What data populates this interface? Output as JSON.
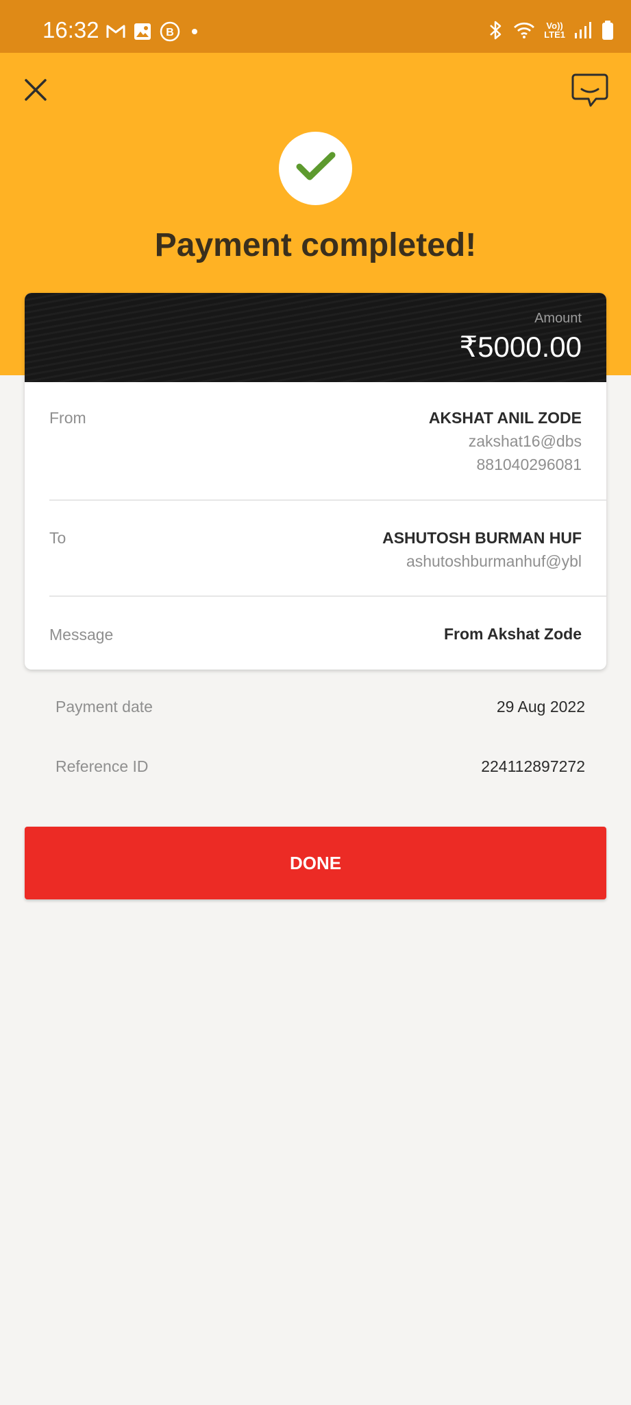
{
  "status_bar": {
    "time": "16:32",
    "left_icons": [
      "gmail-icon",
      "gallery-icon",
      "business-chat-icon",
      "dot-icon"
    ],
    "right_icons": [
      "bluetooth-icon",
      "wifi-icon",
      "volte-icon",
      "signal-icon",
      "battery-icon"
    ],
    "volte_top": "Vo))",
    "volte_bottom": "LTE1"
  },
  "header": {
    "title": "Payment completed!",
    "close_icon": "close-icon",
    "chat_icon": "chat-icon",
    "check_icon": "checkmark-icon",
    "background_color": "#ffb224"
  },
  "card": {
    "amount_label": "Amount",
    "amount": "₹5000.00",
    "from": {
      "label": "From",
      "name": "AKSHAT ANIL ZODE",
      "handle": "zakshat16@dbs",
      "account": "881040296081"
    },
    "to": {
      "label": "To",
      "name": "ASHUTOSH BURMAN HUF",
      "handle": "ashutoshburmanhuf@ybl"
    },
    "message": {
      "label": "Message",
      "value": "From Akshat Zode"
    }
  },
  "details": {
    "payment_date_label": "Payment date",
    "payment_date": "29 Aug 2022",
    "reference_label": "Reference ID",
    "reference_id": "224112897272"
  },
  "done_button": {
    "label": "DONE",
    "color": "#ec2b25"
  }
}
